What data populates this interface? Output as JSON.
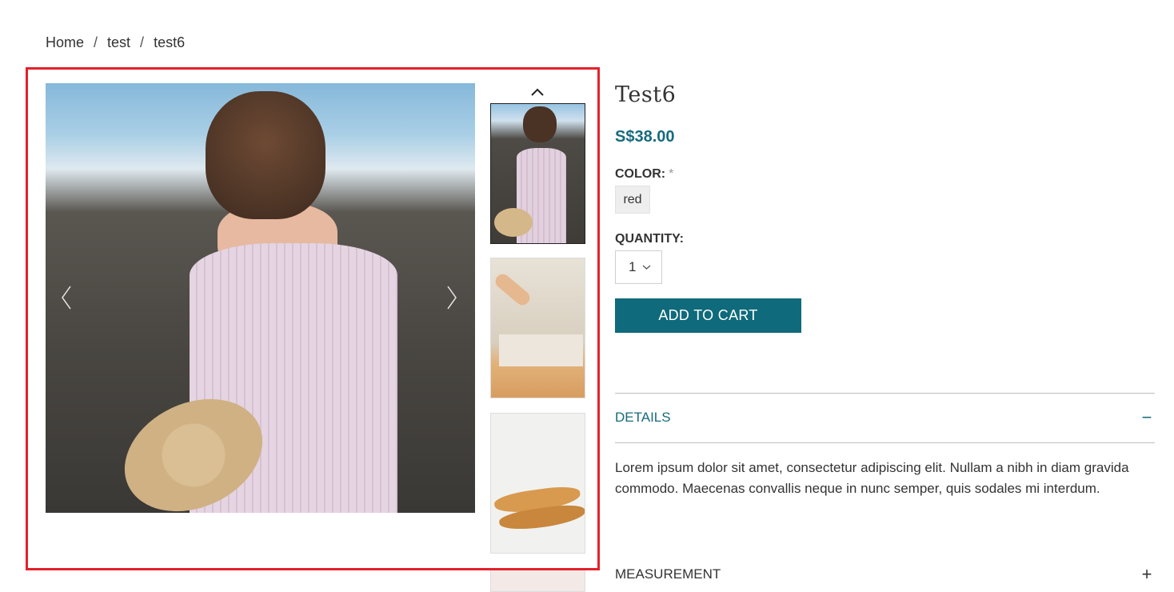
{
  "breadcrumb": {
    "items": [
      "Home",
      "test",
      "test6"
    ],
    "separator": "/"
  },
  "gallery": {
    "prev_icon": "chevron-left-icon",
    "next_icon": "chevron-right-icon",
    "thumbs_up_icon": "chevron-up-icon",
    "main_image": "woman-in-pink-dress-on-rocky-beach",
    "thumbnails": [
      "woman-in-pink-dress-on-rocky-beach",
      "hands-rolling-dough",
      "tan-flip-flop-sandals",
      "partial-thumbnail"
    ]
  },
  "product": {
    "title": "Test6",
    "price": "S$38.00",
    "color_label": "COLOR:",
    "required_mark": "*",
    "color_option": "red",
    "quantity_label": "QUANTITY:",
    "quantity_value": "1",
    "add_to_cart": "ADD TO CART"
  },
  "accordion": {
    "details_label": "DETAILS",
    "details_toggle": "−",
    "details_text": "Lorem ipsum dolor sit amet, consectetur adipiscing elit. Nullam a nibh in diam gravida commodo. Maecenas convallis neque in nunc semper, quis sodales mi interdum.",
    "measurement_label": "MEASUREMENT",
    "measurement_toggle": "+"
  },
  "colors": {
    "accent": "#0f6a7b",
    "price": "#176b7d",
    "highlight": "#e3212b"
  }
}
